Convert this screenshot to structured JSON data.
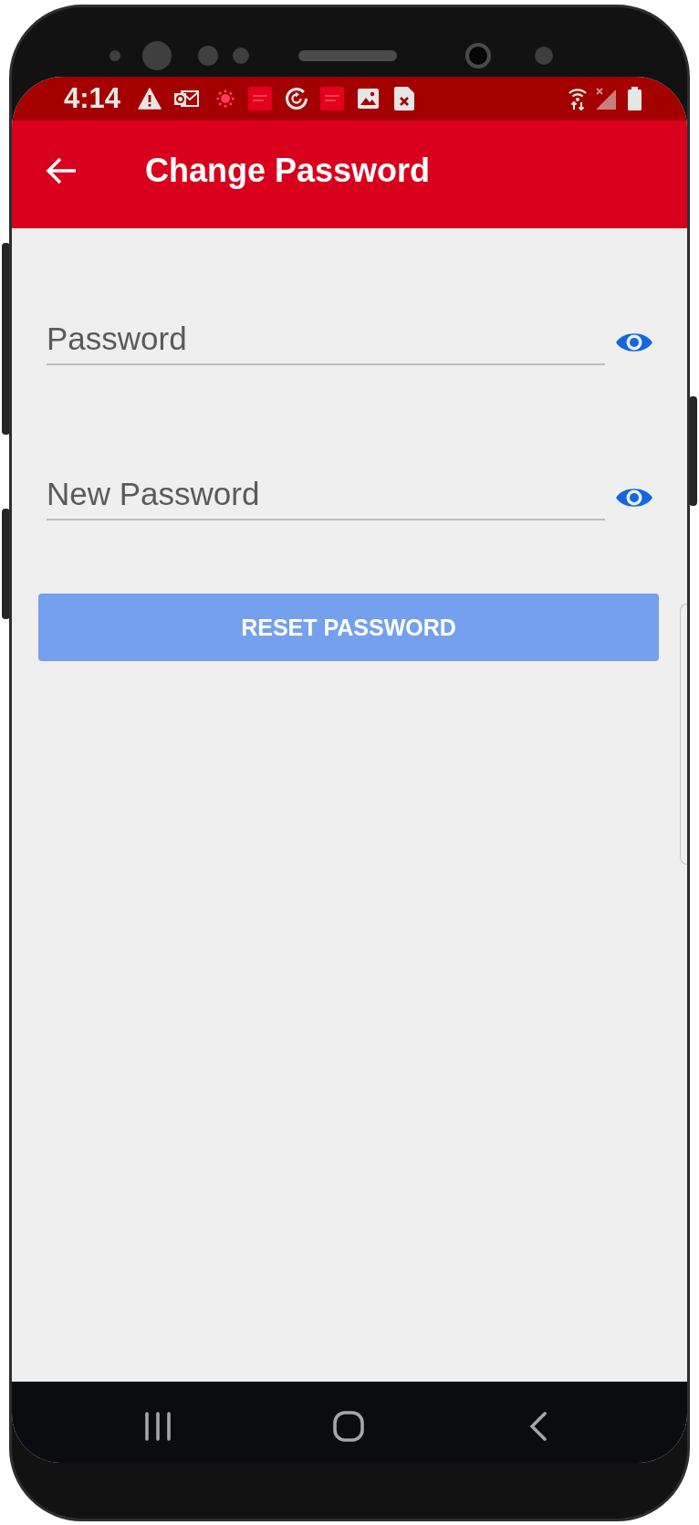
{
  "status_bar": {
    "time": "4:14"
  },
  "app_bar": {
    "title": "Change Password"
  },
  "fields": [
    {
      "placeholder": "Password"
    },
    {
      "placeholder": "New Password"
    }
  ],
  "reset_button": {
    "label": "RESET PASSWORD",
    "disabled": true
  }
}
